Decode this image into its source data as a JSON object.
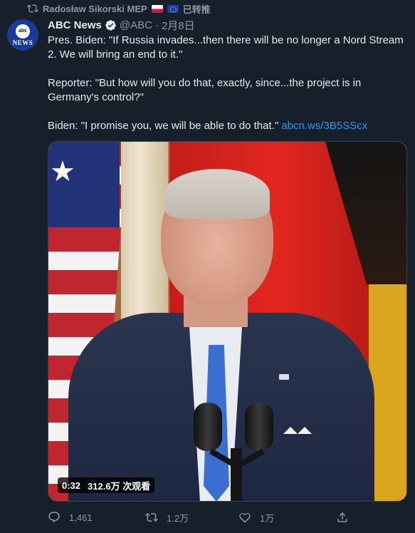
{
  "retweet": {
    "user": "Radosław Sikorski MEP",
    "label": "已转推",
    "icon": "retweet-icon"
  },
  "tweet": {
    "avatar": {
      "logo_text": "abc",
      "news_text": "NEWS"
    },
    "author_name": "ABC News",
    "handle": "@ABC",
    "separator": "·",
    "date": "2月8日",
    "paragraphs": [
      "Pres. Biden: \"If Russia invades...then there will be no longer a Nord Stream 2. We will bring an end to it.\"",
      "Reporter: \"But how will you do that, exactly, since...the project is in Germany's control?\""
    ],
    "last_paragraph": "Biden: \"I promise you, we will be able to do that.\"",
    "link": "abcn.ws/3B5SScx"
  },
  "video": {
    "duration": "0:32",
    "views": "312.6万 次观看"
  },
  "actions": {
    "reply_count": "1,461",
    "retweet_count": "1.2万",
    "like_count": "1万"
  },
  "colors": {
    "background": "#15202b",
    "text": "#e7e9ea",
    "secondary": "#8b98a5",
    "link": "#1d9bf0"
  }
}
